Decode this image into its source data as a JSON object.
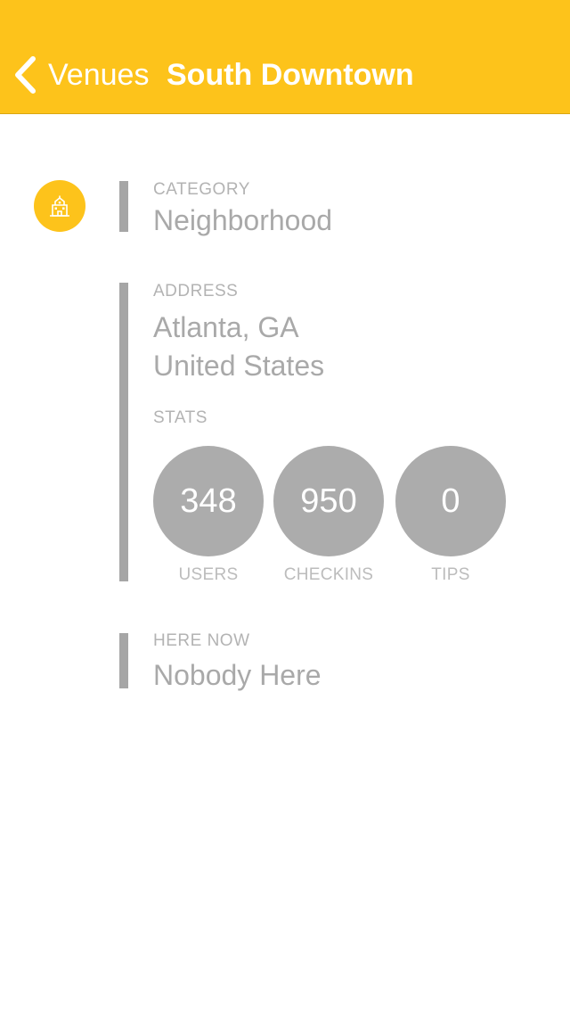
{
  "nav": {
    "back_label": "Venues",
    "title": "South Downtown",
    "background_color": "#fdc31b"
  },
  "venue": {
    "category_icon": "neighborhood-building-icon",
    "category_label": "CATEGORY",
    "category_value": "Neighborhood",
    "address_label": "ADDRESS",
    "address_line1": "Atlanta, GA",
    "address_line2": "United States",
    "stats_label": "STATS",
    "stats": [
      {
        "value": "348",
        "label": "USERS"
      },
      {
        "value": "950",
        "label": "CHECKINS"
      },
      {
        "value": "0",
        "label": "TIPS"
      }
    ],
    "here_now_label": "HERE NOW",
    "here_now_value": "Nobody Here"
  }
}
